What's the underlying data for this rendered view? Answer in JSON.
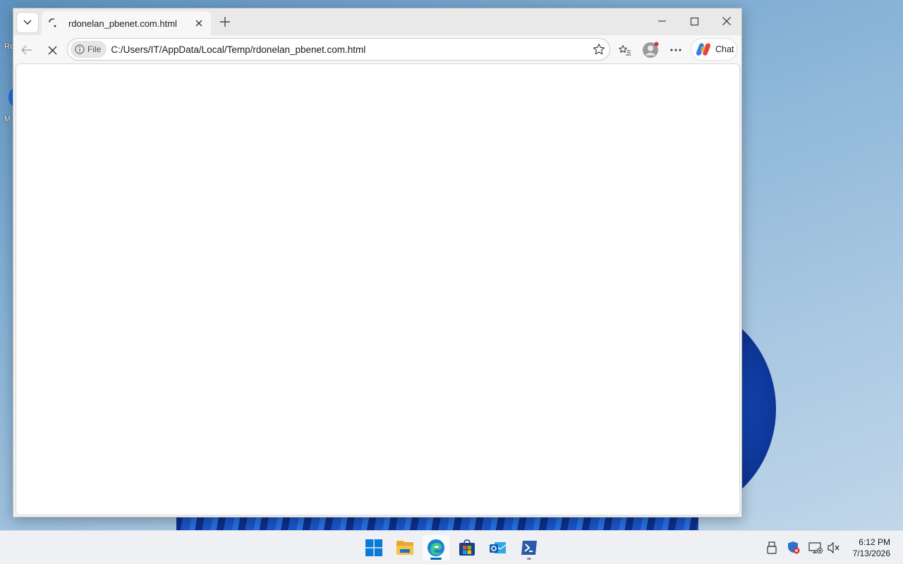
{
  "desktop": {
    "icon_labels": [
      "Re",
      "M"
    ]
  },
  "browser": {
    "tab": {
      "title": "rdonelan_pbenet.com.html"
    },
    "address": {
      "scheme_label": "File",
      "url": "C:/Users/IT/AppData/Local/Temp/rdonelan_pbenet.com.html"
    },
    "chat_label": "Chat"
  },
  "taskbar": {
    "apps": [
      "start-icon",
      "file-explorer-icon",
      "edge-icon",
      "store-icon",
      "outlook-icon",
      "terminal-icon"
    ],
    "clock": {
      "time": "6:12 PM",
      "date": "7/13/2026"
    }
  },
  "colors": {
    "accent": "#0067c0",
    "edge_blue": "#1b7fd6",
    "folder_yellow": "#f6c343",
    "notification_red": "#d13438"
  }
}
